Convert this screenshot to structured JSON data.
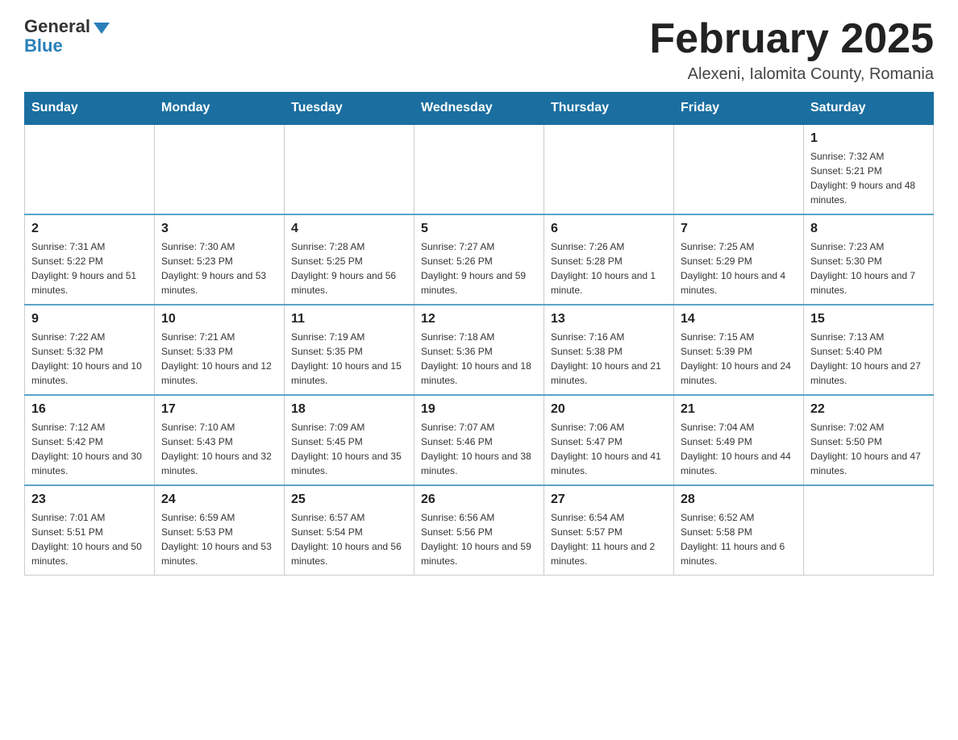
{
  "header": {
    "logo_general": "General",
    "logo_blue": "Blue",
    "month_title": "February 2025",
    "subtitle": "Alexeni, Ialomita County, Romania"
  },
  "days_of_week": [
    "Sunday",
    "Monday",
    "Tuesday",
    "Wednesday",
    "Thursday",
    "Friday",
    "Saturday"
  ],
  "weeks": [
    [
      {
        "day": "",
        "info": "",
        "empty": true
      },
      {
        "day": "",
        "info": "",
        "empty": true
      },
      {
        "day": "",
        "info": "",
        "empty": true
      },
      {
        "day": "",
        "info": "",
        "empty": true
      },
      {
        "day": "",
        "info": "",
        "empty": true
      },
      {
        "day": "",
        "info": "",
        "empty": true
      },
      {
        "day": "1",
        "info": "Sunrise: 7:32 AM\nSunset: 5:21 PM\nDaylight: 9 hours and 48 minutes.",
        "empty": false
      }
    ],
    [
      {
        "day": "2",
        "info": "Sunrise: 7:31 AM\nSunset: 5:22 PM\nDaylight: 9 hours and 51 minutes.",
        "empty": false
      },
      {
        "day": "3",
        "info": "Sunrise: 7:30 AM\nSunset: 5:23 PM\nDaylight: 9 hours and 53 minutes.",
        "empty": false
      },
      {
        "day": "4",
        "info": "Sunrise: 7:28 AM\nSunset: 5:25 PM\nDaylight: 9 hours and 56 minutes.",
        "empty": false
      },
      {
        "day": "5",
        "info": "Sunrise: 7:27 AM\nSunset: 5:26 PM\nDaylight: 9 hours and 59 minutes.",
        "empty": false
      },
      {
        "day": "6",
        "info": "Sunrise: 7:26 AM\nSunset: 5:28 PM\nDaylight: 10 hours and 1 minute.",
        "empty": false
      },
      {
        "day": "7",
        "info": "Sunrise: 7:25 AM\nSunset: 5:29 PM\nDaylight: 10 hours and 4 minutes.",
        "empty": false
      },
      {
        "day": "8",
        "info": "Sunrise: 7:23 AM\nSunset: 5:30 PM\nDaylight: 10 hours and 7 minutes.",
        "empty": false
      }
    ],
    [
      {
        "day": "9",
        "info": "Sunrise: 7:22 AM\nSunset: 5:32 PM\nDaylight: 10 hours and 10 minutes.",
        "empty": false
      },
      {
        "day": "10",
        "info": "Sunrise: 7:21 AM\nSunset: 5:33 PM\nDaylight: 10 hours and 12 minutes.",
        "empty": false
      },
      {
        "day": "11",
        "info": "Sunrise: 7:19 AM\nSunset: 5:35 PM\nDaylight: 10 hours and 15 minutes.",
        "empty": false
      },
      {
        "day": "12",
        "info": "Sunrise: 7:18 AM\nSunset: 5:36 PM\nDaylight: 10 hours and 18 minutes.",
        "empty": false
      },
      {
        "day": "13",
        "info": "Sunrise: 7:16 AM\nSunset: 5:38 PM\nDaylight: 10 hours and 21 minutes.",
        "empty": false
      },
      {
        "day": "14",
        "info": "Sunrise: 7:15 AM\nSunset: 5:39 PM\nDaylight: 10 hours and 24 minutes.",
        "empty": false
      },
      {
        "day": "15",
        "info": "Sunrise: 7:13 AM\nSunset: 5:40 PM\nDaylight: 10 hours and 27 minutes.",
        "empty": false
      }
    ],
    [
      {
        "day": "16",
        "info": "Sunrise: 7:12 AM\nSunset: 5:42 PM\nDaylight: 10 hours and 30 minutes.",
        "empty": false
      },
      {
        "day": "17",
        "info": "Sunrise: 7:10 AM\nSunset: 5:43 PM\nDaylight: 10 hours and 32 minutes.",
        "empty": false
      },
      {
        "day": "18",
        "info": "Sunrise: 7:09 AM\nSunset: 5:45 PM\nDaylight: 10 hours and 35 minutes.",
        "empty": false
      },
      {
        "day": "19",
        "info": "Sunrise: 7:07 AM\nSunset: 5:46 PM\nDaylight: 10 hours and 38 minutes.",
        "empty": false
      },
      {
        "day": "20",
        "info": "Sunrise: 7:06 AM\nSunset: 5:47 PM\nDaylight: 10 hours and 41 minutes.",
        "empty": false
      },
      {
        "day": "21",
        "info": "Sunrise: 7:04 AM\nSunset: 5:49 PM\nDaylight: 10 hours and 44 minutes.",
        "empty": false
      },
      {
        "day": "22",
        "info": "Sunrise: 7:02 AM\nSunset: 5:50 PM\nDaylight: 10 hours and 47 minutes.",
        "empty": false
      }
    ],
    [
      {
        "day": "23",
        "info": "Sunrise: 7:01 AM\nSunset: 5:51 PM\nDaylight: 10 hours and 50 minutes.",
        "empty": false
      },
      {
        "day": "24",
        "info": "Sunrise: 6:59 AM\nSunset: 5:53 PM\nDaylight: 10 hours and 53 minutes.",
        "empty": false
      },
      {
        "day": "25",
        "info": "Sunrise: 6:57 AM\nSunset: 5:54 PM\nDaylight: 10 hours and 56 minutes.",
        "empty": false
      },
      {
        "day": "26",
        "info": "Sunrise: 6:56 AM\nSunset: 5:56 PM\nDaylight: 10 hours and 59 minutes.",
        "empty": false
      },
      {
        "day": "27",
        "info": "Sunrise: 6:54 AM\nSunset: 5:57 PM\nDaylight: 11 hours and 2 minutes.",
        "empty": false
      },
      {
        "day": "28",
        "info": "Sunrise: 6:52 AM\nSunset: 5:58 PM\nDaylight: 11 hours and 6 minutes.",
        "empty": false
      },
      {
        "day": "",
        "info": "",
        "empty": true
      }
    ]
  ]
}
